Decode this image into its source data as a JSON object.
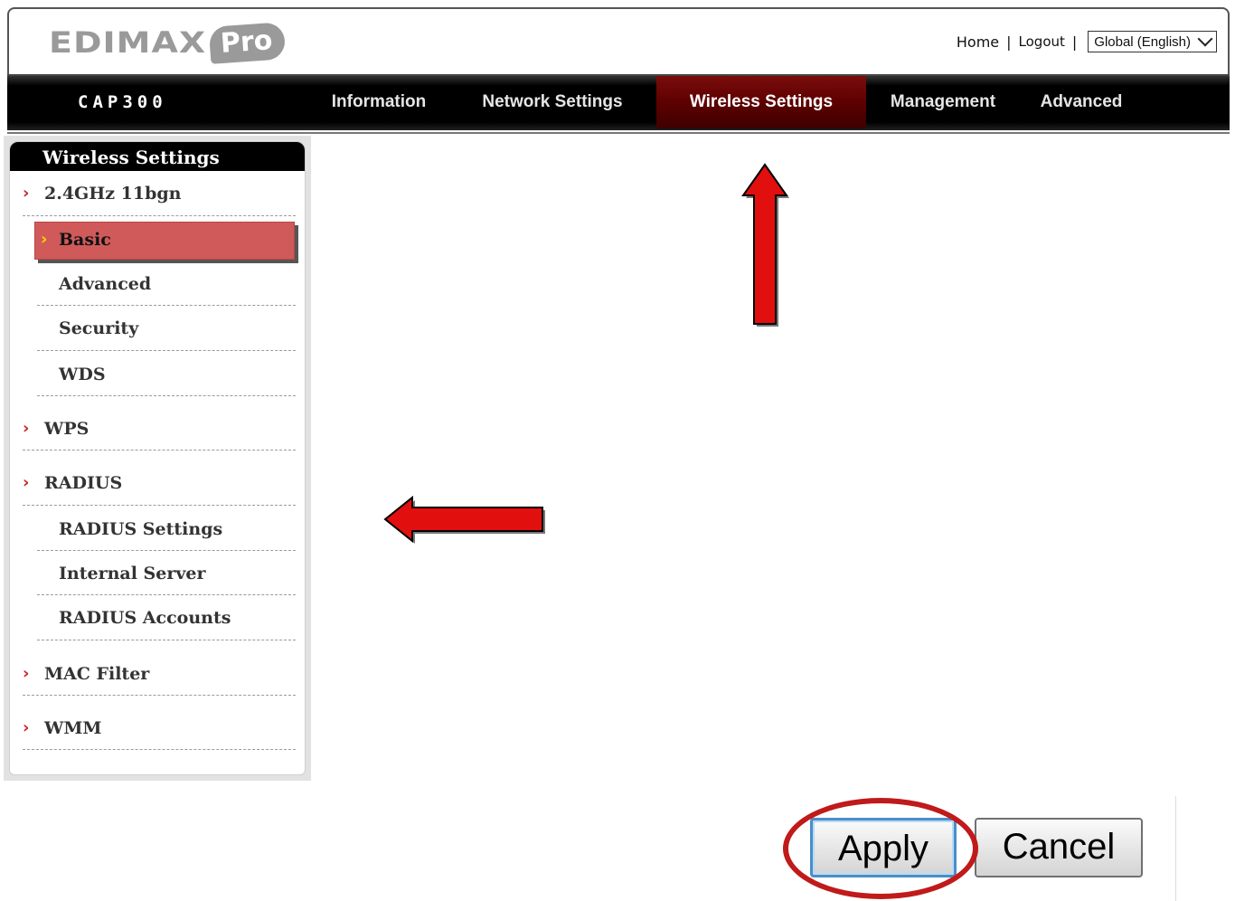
{
  "header": {
    "logo_text": "EDIMAX",
    "logo_badge": "Pro",
    "links": {
      "home": "Home",
      "logout": "Logout",
      "sep": "|"
    },
    "language": {
      "selected": "Global (English)"
    }
  },
  "nav": {
    "model": "CAP300",
    "items": [
      {
        "label": "Information"
      },
      {
        "label": "Network Settings"
      },
      {
        "label": "Wireless Settings",
        "active": true
      },
      {
        "label": "Management"
      },
      {
        "label": "Advanced"
      }
    ]
  },
  "sidebar": {
    "title": "Wireless Settings",
    "groups": {
      "band": "2.4GHz 11bgn",
      "band_items": [
        "Basic",
        "Advanced",
        "Security",
        "WDS"
      ],
      "wps": "WPS",
      "radius": "RADIUS",
      "radius_items": [
        "RADIUS Settings",
        "Internal Server",
        "RADIUS Accounts"
      ],
      "mac": "MAC Filter",
      "wmm": "WMM"
    }
  },
  "buttons": {
    "apply": "Apply",
    "cancel": "Cancel"
  },
  "colors": {
    "accent_red": "#c01a1a",
    "nav_active": "#5e0000",
    "sidebar_active": "#d05a5a"
  }
}
